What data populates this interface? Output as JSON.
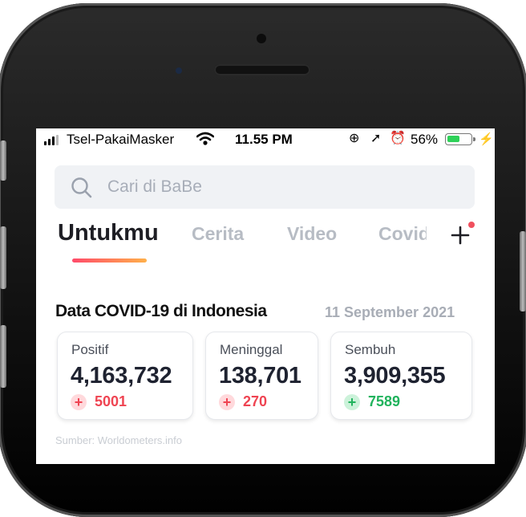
{
  "status_bar": {
    "carrier": "Tsel-PakaiMasker",
    "time": "11.55 PM",
    "battery_percent": "56%",
    "battery_level": 0.56,
    "icons": [
      "signal-icon",
      "wifi-icon",
      "orientation-lock-icon",
      "location-icon",
      "alarm-icon",
      "battery-icon",
      "charging-bolt-icon"
    ]
  },
  "search": {
    "placeholder": "Cari di BaBe"
  },
  "tabs": [
    {
      "label": "Untukmu",
      "active": true
    },
    {
      "label": "Cerita",
      "active": false
    },
    {
      "label": "Video",
      "active": false
    },
    {
      "label": "Covid",
      "active": false
    }
  ],
  "add_tab_icon": "plus-icon",
  "covid": {
    "title": "Data COVID-19 di Indonesia",
    "date": "11 September 2021",
    "cards": [
      {
        "label": "Positif",
        "value": "4,163,732",
        "delta": "5001",
        "sign": "+",
        "tone": "red"
      },
      {
        "label": "Meninggal",
        "value": "138,701",
        "delta": "270",
        "sign": "+",
        "tone": "red"
      },
      {
        "label": "Sembuh",
        "value": "3,909,355",
        "delta": "7589",
        "sign": "+",
        "tone": "green"
      }
    ],
    "source": "Sumber: Worldometers.info"
  },
  "colors": {
    "accent_gradient": [
      "#ff4a6a",
      "#ffb04a"
    ],
    "negative": "#ef4452",
    "positive": "#21b35d",
    "battery": "#2ed158"
  }
}
